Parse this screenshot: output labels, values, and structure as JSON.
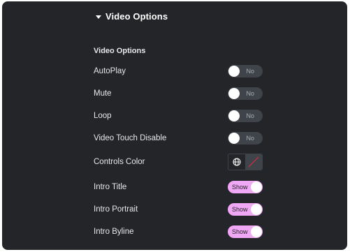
{
  "section": {
    "title": "Video Options"
  },
  "group": {
    "title": "Video Options"
  },
  "rows": [
    {
      "label": "AutoPlay",
      "toggle": "No",
      "checked": false
    },
    {
      "label": "Mute",
      "toggle": "No",
      "checked": false
    },
    {
      "label": "Loop",
      "toggle": "No",
      "checked": false
    },
    {
      "label": "Video Touch Disable",
      "toggle": "No",
      "checked": false
    },
    {
      "label": "Controls Color"
    },
    {
      "label": "Intro Title",
      "toggle": "Show",
      "checked": true
    },
    {
      "label": "Intro Portrait",
      "toggle": "Show",
      "checked": true
    },
    {
      "label": "Intro Byline",
      "toggle": "Show",
      "checked": true
    }
  ],
  "colors": {
    "panel_bg": "#242528",
    "toggle_off_bg": "#3f444b",
    "toggle_on_bg": "#f0a7f5",
    "swatch_slash": "#d72b3f"
  },
  "icons": {
    "section_toggle": "caret-down-icon",
    "global_colors": "globe-icon",
    "no_color": "slash-icon"
  }
}
